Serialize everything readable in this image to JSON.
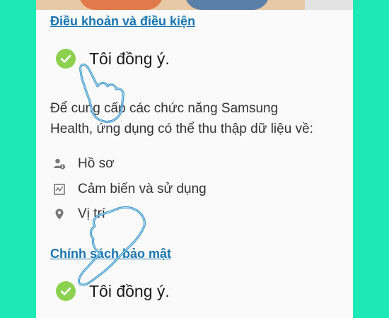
{
  "terms": {
    "title": "Điều khoản và điều kiện",
    "agree_label": "Tôi đồng ý."
  },
  "description": {
    "line1": "Để cung cấp các chức năng Samsung",
    "line2": "Health, ứng dụng có thể thu thập dữ liệu về:"
  },
  "permissions": [
    {
      "label": "Hồ sơ",
      "icon": "profile-info-icon"
    },
    {
      "label": "Cảm biến và sử dụng",
      "icon": "sensor-chart-icon"
    },
    {
      "label": "Vị trí",
      "icon": "location-pin-icon"
    }
  ],
  "privacy": {
    "title": "Chính sách bảo mật",
    "agree_label": "Tôi đồng ý."
  },
  "colors": {
    "background": "#1de9b6",
    "link": "#1976b2",
    "check": "#8bd14e"
  }
}
